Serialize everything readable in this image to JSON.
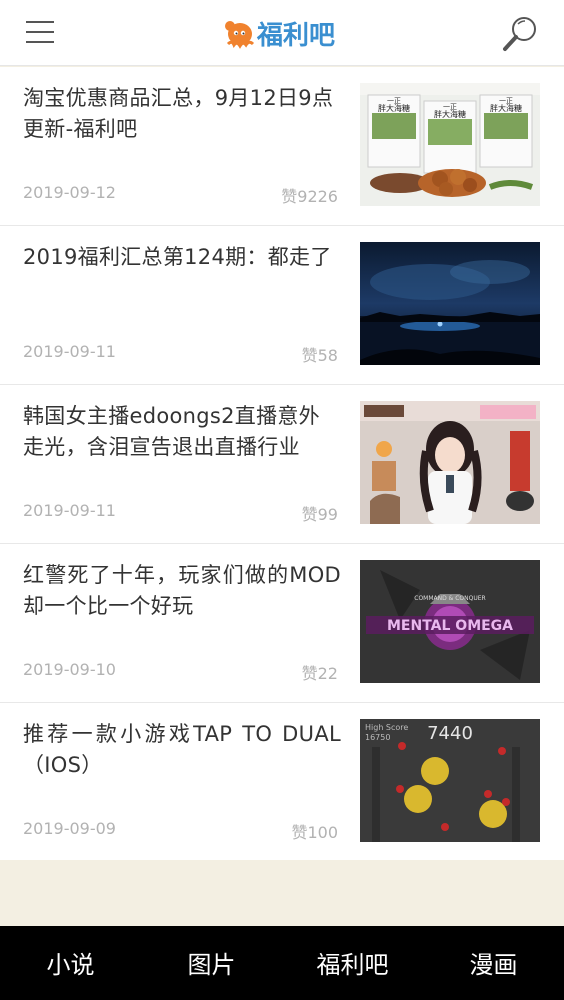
{
  "header": {
    "menu_icon": "hamburger-menu-icon",
    "logo_text": "福利吧",
    "search_icon": "magnifier-icon",
    "brand_color": "#3a8fd0",
    "logo_mark_color": "#f0822e"
  },
  "articles": [
    {
      "title": "淘宝优惠商品汇总，9月12日9点更新-福利吧",
      "date": "2019-09-12",
      "likes": "赞9226"
    },
    {
      "title": "2019福利汇总第124期：都走了",
      "date": "2019-09-11",
      "likes": "赞58"
    },
    {
      "title": "韩国女主播edoongs2直播意外走光，含泪宣告退出直播行业",
      "date": "2019-09-11",
      "likes": "赞99"
    },
    {
      "title": "红警死了十年，玩家们做的MOD却一个比一个好玩",
      "date": "2019-09-10",
      "likes": "赞22"
    },
    {
      "title": "推荐一款小游戏TAP TO DUAL（IOS）",
      "date": "2019-09-09",
      "likes": "赞100"
    }
  ],
  "thumb_text": {
    "product_label_top": "一正",
    "product_label": "胖大海糖",
    "game_logo_top": "COMMAND & CONQUER",
    "game_logo": "MENTAL OMEGA",
    "high_score_label": "High Score",
    "high_score_value": "16750",
    "score": "7440"
  },
  "tabbar": {
    "tabs": [
      "小说",
      "图片",
      "福利吧",
      "漫画"
    ]
  }
}
